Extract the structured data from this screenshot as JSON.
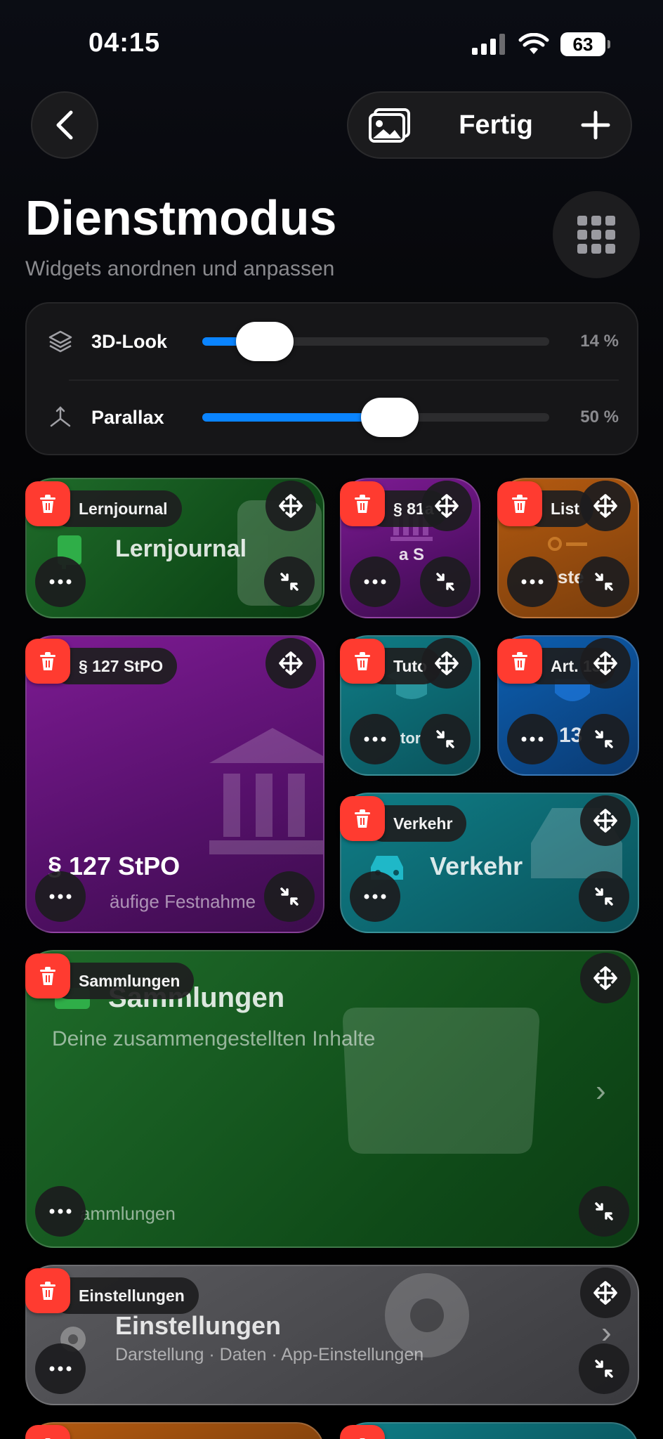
{
  "status": {
    "time": "04:15",
    "battery": "63"
  },
  "header": {
    "done_label": "Fertig",
    "title": "Dienstmodus",
    "subtitle": "Widgets anordnen und anpassen"
  },
  "sliders": [
    {
      "label": "3D-Look",
      "value": 14,
      "display": "14 %"
    },
    {
      "label": "Parallax",
      "value": 50,
      "display": "50 %"
    }
  ],
  "widgets": {
    "lernjournal": {
      "tag": "Lernjournal",
      "title": "Lernjournal"
    },
    "s81": {
      "tag": "§ 81a",
      "title": "a S"
    },
    "list": {
      "tag": "List",
      "title": "ste"
    },
    "stpo": {
      "tag": "§ 127 StPO",
      "title": "§ 127 StPO",
      "subtitle": "äufige Festnahme"
    },
    "tuto": {
      "tag": "Tuto",
      "title": "tor"
    },
    "art": {
      "tag": "Art. 13",
      "title": "13"
    },
    "verkehr": {
      "tag": "Verkehr",
      "title": "Verkehr"
    },
    "sammlungen": {
      "tag": "Sammlungen",
      "title": "Sammlungen",
      "subtitle": "Deine zusammengestellten Inhalte",
      "footer": "ammlungen"
    },
    "einstellungen": {
      "tag": "Einstellungen",
      "title": "Einstellungen",
      "subtitle": "Darstellung · Daten · App-Einstellungen"
    }
  }
}
